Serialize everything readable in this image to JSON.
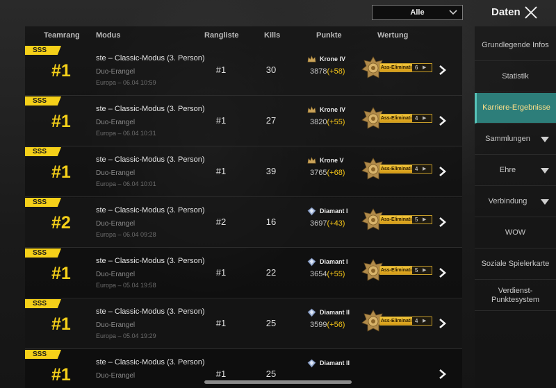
{
  "header": {
    "filter_value": "Alle",
    "title": "Daten"
  },
  "columns": [
    "Teamrang",
    "Modus",
    "Rangliste",
    "Kills",
    "Punkte",
    "Wertung"
  ],
  "rows": [
    {
      "badge": "SSS",
      "rank": "#1",
      "mode": "ste – Classic-Modus (3. Person)",
      "map": "Duo-Erangel",
      "meta": "Europa – 06.04 10:59",
      "leaderboard": "#1",
      "kills": "30",
      "tier": "Krone IV",
      "points": "3878",
      "delta": "(+58)",
      "rating": "Ass-Eliminati",
      "rating_count": "6"
    },
    {
      "badge": "SSS",
      "rank": "#1",
      "mode": "ste – Classic-Modus (3. Person)",
      "map": "Duo-Erangel",
      "meta": "Europa – 06.04 10:31",
      "leaderboard": "#1",
      "kills": "27",
      "tier": "Krone IV",
      "points": "3820",
      "delta": "(+55)",
      "rating": "Ass-Eliminati",
      "rating_count": "4"
    },
    {
      "badge": "SSS",
      "rank": "#1",
      "mode": "ste – Classic-Modus (3. Person)",
      "map": "Duo-Erangel",
      "meta": "Europa – 06.04 10:01",
      "leaderboard": "#1",
      "kills": "39",
      "tier": "Krone V",
      "points": "3765",
      "delta": "(+68)",
      "rating": "Ass-Eliminati",
      "rating_count": "4"
    },
    {
      "badge": "SSS",
      "rank": "#2",
      "mode": "ste – Classic-Modus (3. Person)",
      "map": "Duo-Erangel",
      "meta": "Europa – 06.04 09:28",
      "leaderboard": "#2",
      "kills": "16",
      "tier": "Diamant I",
      "points": "3697",
      "delta": "(+43)",
      "rating": "Ass-Eliminati",
      "rating_count": "5"
    },
    {
      "badge": "SSS",
      "rank": "#1",
      "mode": "ste – Classic-Modus (3. Person)",
      "map": "Duo-Erangel",
      "meta": "Europa – 05.04 19:58",
      "leaderboard": "#1",
      "kills": "22",
      "tier": "Diamant I",
      "points": "3654",
      "delta": "(+55)",
      "rating": "Ass-Eliminati",
      "rating_count": "5"
    },
    {
      "badge": "SSS",
      "rank": "#1",
      "mode": "ste – Classic-Modus (3. Person)",
      "map": "Duo-Erangel",
      "meta": "Europa – 05.04 19:29",
      "leaderboard": "#1",
      "kills": "25",
      "tier": "Diamant II",
      "points": "3599",
      "delta": "(+56)",
      "rating": "Ass-Eliminati",
      "rating_count": "4"
    },
    {
      "badge": "SSS",
      "rank": "#1",
      "mode": "ste – Classic-Modus (3. Person)",
      "map": "Duo-Erangel",
      "meta": "",
      "leaderboard": "#1",
      "kills": "25",
      "tier": "Diamant II",
      "points": "",
      "delta": "",
      "rating": "",
      "rating_count": ""
    }
  ],
  "sidebar": [
    {
      "label": "Grundlegende Infos",
      "dropdown": false,
      "active": false
    },
    {
      "label": "Statistik",
      "dropdown": false,
      "active": false
    },
    {
      "label": "Karriere-Ergebnisse",
      "dropdown": false,
      "active": true
    },
    {
      "label": "Sammlungen",
      "dropdown": true,
      "active": false
    },
    {
      "label": "Ehre",
      "dropdown": true,
      "active": false
    },
    {
      "label": "Verbindung",
      "dropdown": true,
      "active": false
    },
    {
      "label": "WOW",
      "dropdown": false,
      "active": false
    },
    {
      "label": "Soziale Spielerkarte",
      "dropdown": false,
      "active": false
    },
    {
      "label": "Verdienst-Punktesystem",
      "dropdown": false,
      "active": false
    }
  ],
  "colors": {
    "accent_yellow": "#f5d019",
    "active_teal": "#2d7e7a",
    "points_delta": "#f5c518"
  },
  "icons": [
    "chevron-down-icon",
    "close-icon",
    "crown-tier-icon",
    "diamond-tier-icon",
    "ace-eliminator-emblem-icon",
    "chevron-right-icon"
  ]
}
